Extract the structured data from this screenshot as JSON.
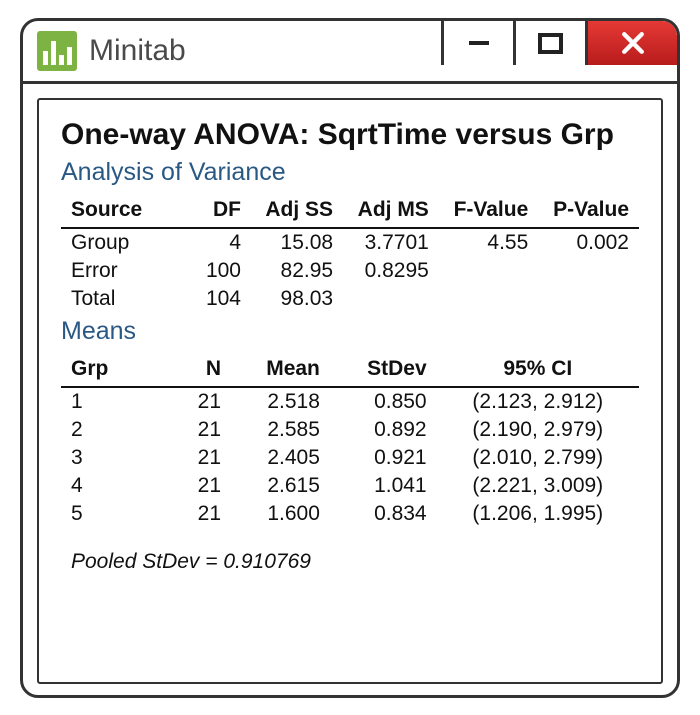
{
  "app": {
    "title": "Minitab"
  },
  "page": {
    "title": "One-way ANOVA: SqrtTime versus Grp",
    "section1": "Analysis of Variance",
    "section2": "Means",
    "pooled": "Pooled StDev = 0.910769"
  },
  "anova": {
    "headers": [
      "Source",
      "DF",
      "Adj SS",
      "Adj MS",
      "F-Value",
      "P-Value"
    ],
    "rows": [
      {
        "src": "Group",
        "df": "4",
        "ss": "15.08",
        "ms": "3.7701",
        "f": "4.55",
        "p": "0.002"
      },
      {
        "src": "Error",
        "df": "100",
        "ss": "82.95",
        "ms": "0.8295",
        "f": "",
        "p": ""
      },
      {
        "src": "Total",
        "df": "104",
        "ss": "98.03",
        "ms": "",
        "f": "",
        "p": ""
      }
    ]
  },
  "means": {
    "headers": [
      "Grp",
      "N",
      "Mean",
      "StDev",
      "95% CI"
    ],
    "rows": [
      {
        "g": "1",
        "n": "21",
        "m": "2.518",
        "sd": "0.850",
        "ci": "(2.123, 2.912)"
      },
      {
        "g": "2",
        "n": "21",
        "m": "2.585",
        "sd": "0.892",
        "ci": "(2.190, 2.979)"
      },
      {
        "g": "3",
        "n": "21",
        "m": "2.405",
        "sd": "0.921",
        "ci": "(2.010, 2.799)"
      },
      {
        "g": "4",
        "n": "21",
        "m": "2.615",
        "sd": "1.041",
        "ci": "(2.221, 3.009)"
      },
      {
        "g": "5",
        "n": "21",
        "m": "1.600",
        "sd": "0.834",
        "ci": "(1.206, 1.995)"
      }
    ]
  }
}
